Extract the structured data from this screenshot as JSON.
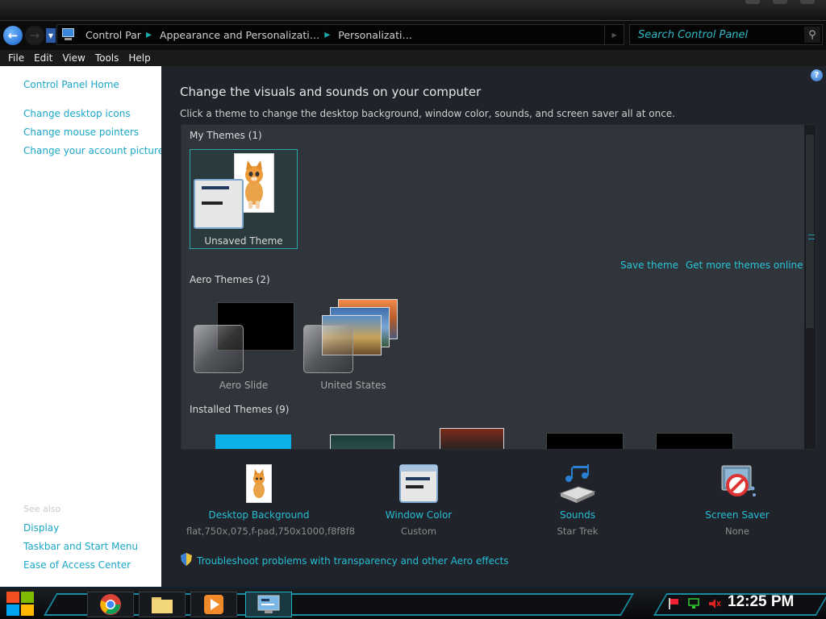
{
  "nav": {
    "back_glyph": "←",
    "forward_glyph": "→",
    "breadcrumbs": [
      "Control Par",
      "Appearance and Personalizati…",
      "Personalizati…"
    ],
    "search_placeholder": "Search Control Panel"
  },
  "menu": [
    "File",
    "Edit",
    "View",
    "Tools",
    "Help"
  ],
  "sidebar": {
    "home": "Control Panel Home",
    "links": [
      "Change desktop icons",
      "Change mouse pointers",
      "Change your account picture"
    ],
    "see_also_label": "See also",
    "see_also": [
      "Display",
      "Taskbar and Start Menu",
      "Ease of Access Center"
    ]
  },
  "main": {
    "title": "Change the visuals and sounds on your computer",
    "subtitle": "Click a theme to change the desktop background, window color, sounds, and screen saver all at once.",
    "help_glyph": "?",
    "my_themes": {
      "header": "My Themes (1)",
      "items": [
        "Unsaved Theme"
      ]
    },
    "save_theme": "Save theme",
    "get_more": "Get more themes online",
    "aero_themes": {
      "header": "Aero Themes (2)",
      "items": [
        "Aero Slide",
        "United States"
      ]
    },
    "installed_themes": {
      "header": "Installed Themes (9)"
    }
  },
  "bottom": {
    "items": [
      {
        "title": "Desktop Background",
        "value": "flat,750x,075,f-pad,750x1000,f8f8f8"
      },
      {
        "title": "Window Color",
        "value": "Custom"
      },
      {
        "title": "Sounds",
        "value": "Star Trek"
      },
      {
        "title": "Screen Saver",
        "value": "None"
      }
    ],
    "troubleshoot": "Troubleshoot problems with transparency and other Aero effects"
  },
  "taskbar": {
    "clock": "12:25 PM"
  },
  "colors": {
    "accent": "#26bfd6",
    "panel": "#20232a",
    "link": "#1aa7c7"
  }
}
